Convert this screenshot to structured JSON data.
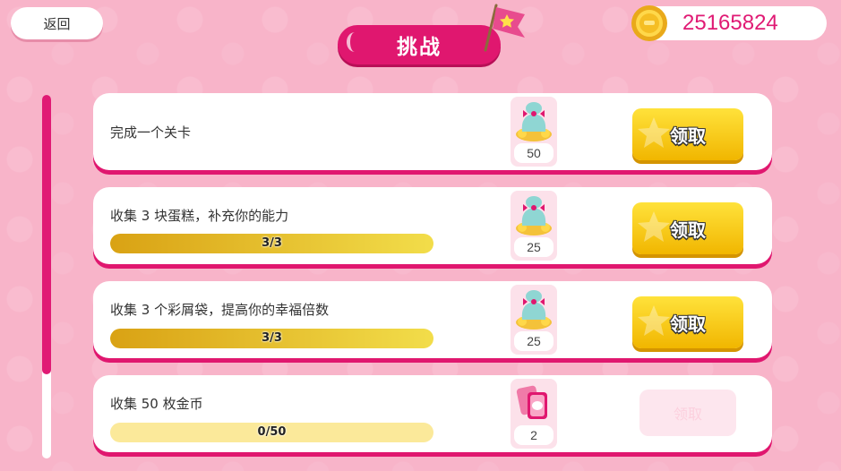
{
  "header": {
    "back_label": "返回",
    "title": "挑战",
    "coins": "25165824"
  },
  "colors": {
    "background": "#f8b4c9",
    "accent": "#e0176f",
    "button_gold": "#ffd21f",
    "progress_gold": "#e0b31c"
  },
  "tasks": [
    {
      "label": "完成一个关卡",
      "progress_text": "",
      "progress": null,
      "reward_icon": "gift-bag-icon",
      "reward_count": "50",
      "button_label": "领取",
      "button_enabled": true
    },
    {
      "label": "收集 3 块蛋糕，补充你的能力",
      "progress_text": "3/3",
      "progress": 1.0,
      "reward_icon": "gift-bag-icon",
      "reward_count": "25",
      "button_label": "领取",
      "button_enabled": true
    },
    {
      "label": "收集 3 个彩屑袋，提高你的幸福倍数",
      "progress_text": "3/3",
      "progress": 1.0,
      "reward_icon": "gift-bag-icon",
      "reward_count": "25",
      "button_label": "领取",
      "button_enabled": true
    },
    {
      "label": "收集 50 枚金币",
      "progress_text": "0/50",
      "progress": 0.0,
      "reward_icon": "cards-icon",
      "reward_count": "2",
      "button_label": "领取",
      "button_enabled": false
    }
  ],
  "scroll": {
    "position": 0.0,
    "visible_fraction": 0.77
  }
}
